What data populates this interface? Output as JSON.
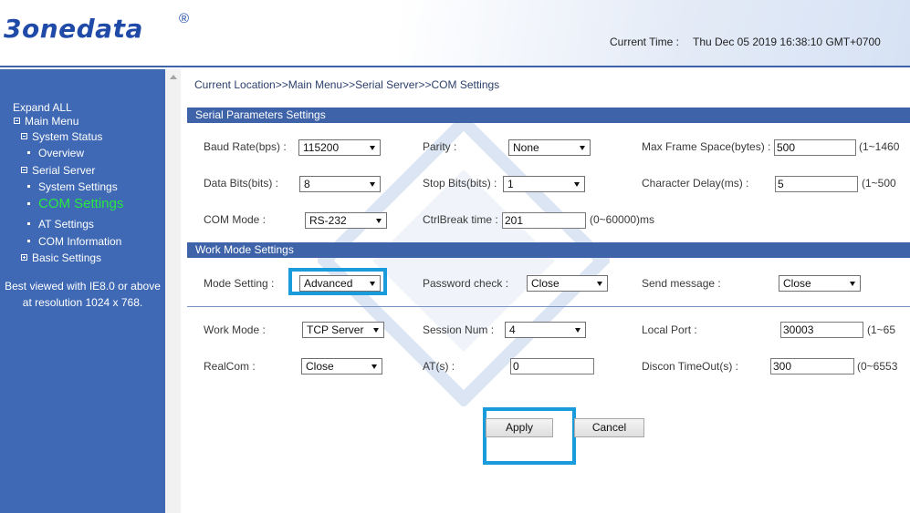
{
  "header": {
    "logo_text": "3onedata",
    "logo_mark": "®",
    "current_time_label": "Current Time :",
    "current_time_value": "Thu Dec 05 2019 16:38:10 GMT+0700"
  },
  "sidebar": {
    "expand_all": "Expand ALL",
    "main_menu": "Main Menu",
    "system_status": "System Status",
    "overview": "Overview",
    "serial_server": "Serial Server",
    "system_settings": "System Settings",
    "com_settings": "COM Settings",
    "at_settings": "AT Settings",
    "com_information": "COM Information",
    "basic_settings": "Basic Settings",
    "best_viewed_line1": "Best viewed with IE8.0 or above",
    "best_viewed_line2": "at resolution 1024 x 768.",
    "active_color": "#29e842"
  },
  "breadcrumb": "Current Location>>Main Menu>>Serial Server>>COM Settings",
  "serial_params": {
    "title": "Serial Parameters Settings",
    "baud_rate_label": "Baud Rate(bps) :",
    "baud_rate_value": "115200",
    "parity_label": "Parity :",
    "parity_value": "None",
    "max_frame_label": "Max Frame Space(bytes) :",
    "max_frame_value": "500",
    "max_frame_range": "(1~1460",
    "data_bits_label": "Data Bits(bits) :",
    "data_bits_value": "8",
    "stop_bits_label": "Stop Bits(bits) :",
    "stop_bits_value": "1",
    "char_delay_label": "Character Delay(ms) :",
    "char_delay_value": "5",
    "char_delay_range": "(1~500",
    "com_mode_label": "COM Mode :",
    "com_mode_value": "RS-232",
    "ctrlbreak_label": "CtrlBreak time :",
    "ctrlbreak_value": "201",
    "ctrlbreak_range": "(0~60000)ms"
  },
  "work_mode": {
    "title": "Work Mode Settings",
    "mode_setting_label": "Mode Setting :",
    "mode_setting_value": "Advanced",
    "password_check_label": "Password check :",
    "password_check_value": "Close",
    "send_message_label": "Send message :",
    "send_message_value": "Close",
    "work_mode_label": "Work Mode :",
    "work_mode_value": "TCP Server",
    "session_num_label": "Session Num :",
    "session_num_value": "4",
    "local_port_label": "Local Port :",
    "local_port_value": "30003",
    "local_port_range": "(1~65",
    "realcom_label": "RealCom :",
    "realcom_value": "Close",
    "at_label": "AT(s) :",
    "at_value": "0",
    "discon_label": "Discon TimeOut(s) :",
    "discon_value": "300",
    "discon_range": "(0~6553"
  },
  "buttons": {
    "apply": "Apply",
    "cancel": "Cancel"
  },
  "colors": {
    "sidebar_bg": "#3f69b4",
    "section_bar": "#3f63a8",
    "highlight": "#1a9bdc",
    "logo": "#1f4aa8"
  }
}
